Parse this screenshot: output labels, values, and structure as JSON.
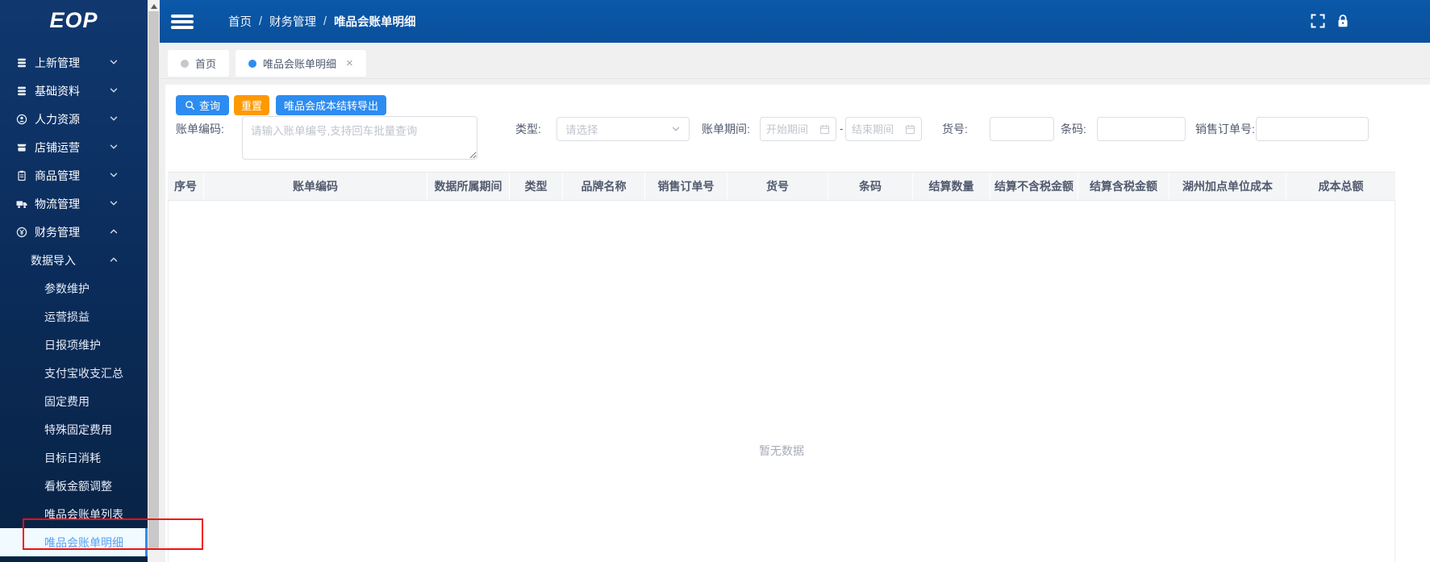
{
  "app": {
    "logo_text": "EOP"
  },
  "navbar": {
    "breadcrumb": {
      "items": [
        "首页",
        "财务管理",
        "唯品会账单明细"
      ],
      "separator": "/"
    },
    "icons": [
      "fullscreen-icon",
      "lock-icon"
    ]
  },
  "tabs": {
    "home": {
      "label": "首页"
    },
    "active": {
      "label": "唯品会账单明细",
      "close": "×"
    }
  },
  "sidebar": {
    "items": [
      {
        "label": "上新管理",
        "icon": "database-icon",
        "expanded": false
      },
      {
        "label": "基础资料",
        "icon": "database-icon",
        "expanded": false
      },
      {
        "label": "人力资源",
        "icon": "user-circle-icon",
        "expanded": false
      },
      {
        "label": "店铺运营",
        "icon": "shop-icon",
        "expanded": false
      },
      {
        "label": "商品管理",
        "icon": "clipboard-icon",
        "expanded": false
      },
      {
        "label": "物流管理",
        "icon": "truck-icon",
        "expanded": false
      },
      {
        "label": "财务管理",
        "icon": "finance-icon",
        "expanded": true
      }
    ],
    "group": {
      "label": "数据导入",
      "expanded": true
    },
    "subitems": [
      "参数维护",
      "运营损益",
      "日报项维护",
      "支付宝收支汇总",
      "固定费用",
      "特殊固定费用",
      "目标日消耗",
      "看板金额调整",
      "唯品会账单列表",
      "唯品会账单明细"
    ],
    "active_subitem": "唯品会账单明细"
  },
  "toolbar": {
    "search_label": "查询",
    "reset_label": "重置",
    "export_label": "唯品会成本结转导出"
  },
  "filters": {
    "bill_code": {
      "label": "账单编码:",
      "value": "",
      "placeholder": "请输入账单编号,支持回车批量查询"
    },
    "type": {
      "label": "类型:",
      "placeholder": "请选择"
    },
    "bill_period": {
      "label": "账单期间:",
      "start_placeholder": "开始期间",
      "end_placeholder": "结束期间",
      "separator": "-"
    },
    "item_no": {
      "label": "货号:",
      "value": ""
    },
    "barcode": {
      "label": "条码:",
      "value": ""
    },
    "sales_order_no": {
      "label": "销售订单号:",
      "value": ""
    }
  },
  "table": {
    "columns": [
      "序号",
      "账单编码",
      "数据所属期间",
      "类型",
      "品牌名称",
      "销售订单号",
      "货号",
      "条码",
      "结算数量",
      "结算不含税金额",
      "结算含税金额",
      "湖州加点单位成本",
      "成本总额"
    ],
    "empty_text": "暂无数据"
  },
  "colors": {
    "accent": "#2d8cf0",
    "warning": "#ff9900",
    "navbar": "#0a55a4",
    "sidebar_top": "#10386f",
    "sidebar_bottom": "#082243",
    "active_item_bg": "#f0faff",
    "active_item_text": "#57a3f3",
    "annotation": "#f50f0f"
  }
}
